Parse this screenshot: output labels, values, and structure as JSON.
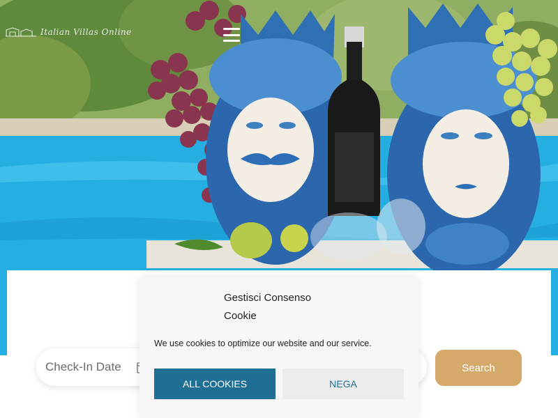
{
  "header": {
    "logo_text": "Italian Villas Online",
    "menu_icon": "hamburger-menu-icon"
  },
  "hero": {
    "image_subject": "Sicilian ceramic Moor head vases with grapes, wine bottle and glasses beside a swimming pool"
  },
  "booking": {
    "checkin_label": "Check-In Date",
    "calendar_icon": "calendar-icon",
    "search_label": "Search"
  },
  "cookie_banner": {
    "title": "Gestisci Consenso Cookie",
    "message": "We use cookies to optimize our website and our service.",
    "accept_all_label": "ALL COOKIES",
    "deny_label": "NEGA"
  },
  "colors": {
    "accent_gold": "#d4a96a",
    "cookie_primary": "#1e6f93",
    "cookie_secondary_bg": "#ececec",
    "banner_bg": "#f7f7f7"
  }
}
